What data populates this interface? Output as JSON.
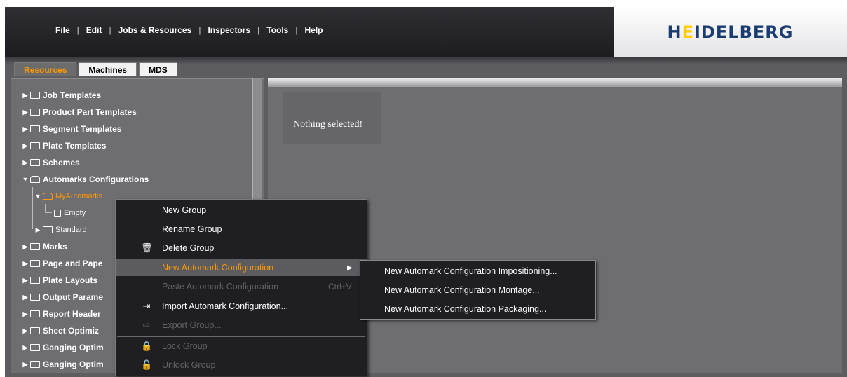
{
  "menubar": {
    "items": [
      "File",
      "Edit",
      "Jobs & Resources",
      "Inspectors",
      "Tools",
      "Help"
    ],
    "separator": "|"
  },
  "logo": {
    "prefix": "H",
    "dash": "E",
    "rest": "IDELBERG",
    "colors": {
      "text": "#1a3c70",
      "dash": "#ffcc00"
    }
  },
  "tabs": [
    {
      "label": "Resources",
      "active": true
    },
    {
      "label": "Machines",
      "active": false
    },
    {
      "label": "MDS",
      "active": false
    }
  ],
  "tree": {
    "items": [
      {
        "label": "Job Templates",
        "expanded": false
      },
      {
        "label": "Product Part Templates",
        "expanded": false
      },
      {
        "label": "Segment Templates",
        "expanded": false
      },
      {
        "label": "Plate Templates",
        "expanded": false
      },
      {
        "label": "Schemes",
        "expanded": false
      },
      {
        "label": "Automarks Configurations",
        "expanded": true
      },
      {
        "label": "MyAutomarks",
        "expanded": true,
        "selected": true
      },
      {
        "label": "Empty"
      },
      {
        "label": "Standard",
        "expanded": false
      },
      {
        "label": "Marks",
        "expanded": false
      },
      {
        "label": "Page and Pape",
        "expanded": false
      },
      {
        "label": "Plate Layouts",
        "expanded": false
      },
      {
        "label": "Output Parame",
        "expanded": false
      },
      {
        "label": "Report Header",
        "expanded": false
      },
      {
        "label": "Sheet Optimiz",
        "expanded": false
      },
      {
        "label": "Ganging Optim",
        "expanded": false
      },
      {
        "label": "Ganging Optim",
        "expanded": false
      }
    ]
  },
  "main": {
    "empty_message": "Nothing selected!"
  },
  "context_menu": {
    "items": [
      {
        "label": "New Group",
        "icon": "",
        "enabled": true
      },
      {
        "label": "Rename Group",
        "icon": "",
        "enabled": true
      },
      {
        "label": "Delete Group",
        "icon": "trash-icon",
        "enabled": true
      },
      {
        "label": "New Automark Configuration",
        "icon": "",
        "enabled": true,
        "highlighted": true,
        "submenu": true
      },
      {
        "label": "Paste Automark Configuration",
        "icon": "",
        "enabled": false,
        "shortcut": "Ctrl+V"
      },
      {
        "label": "Import Automark Configuration...",
        "icon": "import-icon",
        "enabled": true
      },
      {
        "label": "Export Group...",
        "icon": "export-icon",
        "enabled": false
      },
      {
        "label": "Lock Group",
        "icon": "lock-icon",
        "enabled": false
      },
      {
        "label": "Unlock Group",
        "icon": "unlock-icon",
        "enabled": false
      }
    ]
  },
  "sub_menu": {
    "items": [
      "New Automark Configuration Impositioning...",
      "New Automark Configuration Montage...",
      "New Automark Configuration Packaging..."
    ]
  },
  "colors": {
    "accent": "#ff9a00",
    "panel_bg": "#6d6d72",
    "menu_bg": "#1f1f23"
  }
}
